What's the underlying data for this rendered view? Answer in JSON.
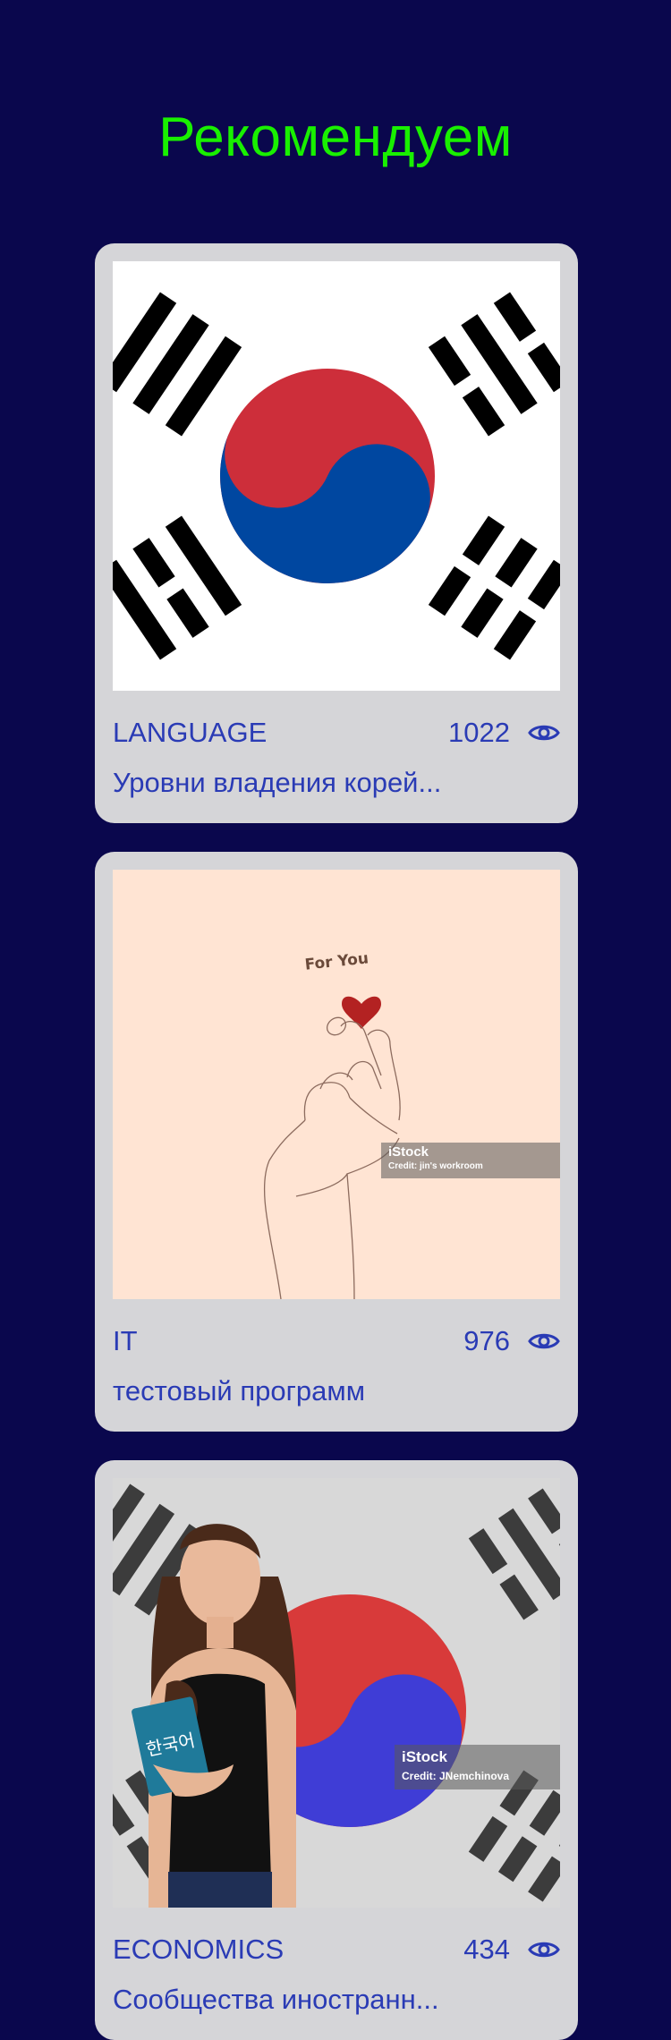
{
  "page": {
    "title": "Рекомендуем"
  },
  "cards": [
    {
      "category": "LANGUAGE",
      "views": "1022",
      "description": "Уровни владения корей...",
      "image": "korean-flag"
    },
    {
      "category": "IT",
      "views": "976",
      "description": "тестовый программ",
      "image": "finger-heart",
      "image_text": "For You",
      "watermark_brand": "iStock",
      "watermark_credit": "Credit: jin's workroom"
    },
    {
      "category": "ECONOMICS",
      "views": "434",
      "description": "Сообщества иностранн...",
      "image": "woman-korean-flag",
      "book_text": "한국어",
      "watermark_brand": "iStock",
      "watermark_credit": "Credit: JNemchinova"
    }
  ],
  "icons": {
    "views": "eye-icon"
  },
  "colors": {
    "background": "#0a074d",
    "title": "#19f000",
    "card": "#d5d5d8",
    "text": "#2a3bb5"
  }
}
